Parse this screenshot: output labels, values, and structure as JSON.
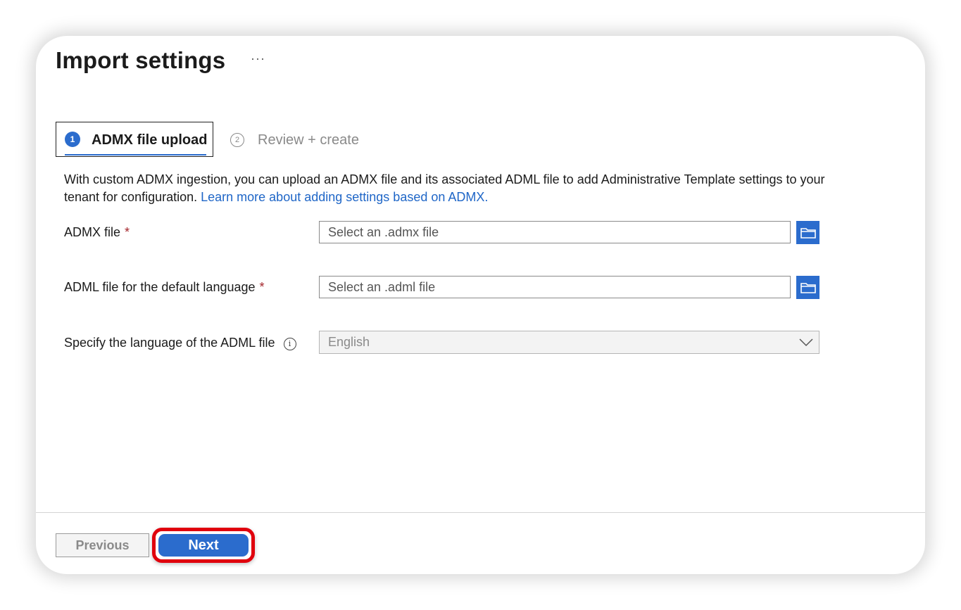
{
  "header": {
    "title": "Import settings",
    "more_label": "···"
  },
  "steps": [
    {
      "number": "1",
      "label": "ADMX file upload",
      "active": true
    },
    {
      "number": "2",
      "label": "Review + create",
      "active": false
    }
  ],
  "description": {
    "text": "With custom ADMX ingestion, you can upload an ADMX file and its associated ADML file to add Administrative Template settings to your tenant for configuration. ",
    "link_text": "Learn more about adding settings based on ADMX."
  },
  "fields": {
    "admx": {
      "label": "ADMX file",
      "required_mark": "*",
      "placeholder": "Select an .admx file"
    },
    "adml": {
      "label": "ADML file for the default language",
      "required_mark": "*",
      "placeholder": "Select an .adml file"
    },
    "language": {
      "label": "Specify the language of the ADML file",
      "info_glyph": "i",
      "selected_value": "English"
    }
  },
  "footer": {
    "previous_label": "Previous",
    "next_label": "Next"
  },
  "colors": {
    "accent": "#2b6ccd",
    "link": "#1f66c7",
    "required": "#a4262c",
    "highlight_outline": "#e0000d"
  },
  "icons": {
    "browse": "folder-icon",
    "dropdown": "chevron-down-icon",
    "info": "info-icon",
    "more": "more-icon"
  }
}
